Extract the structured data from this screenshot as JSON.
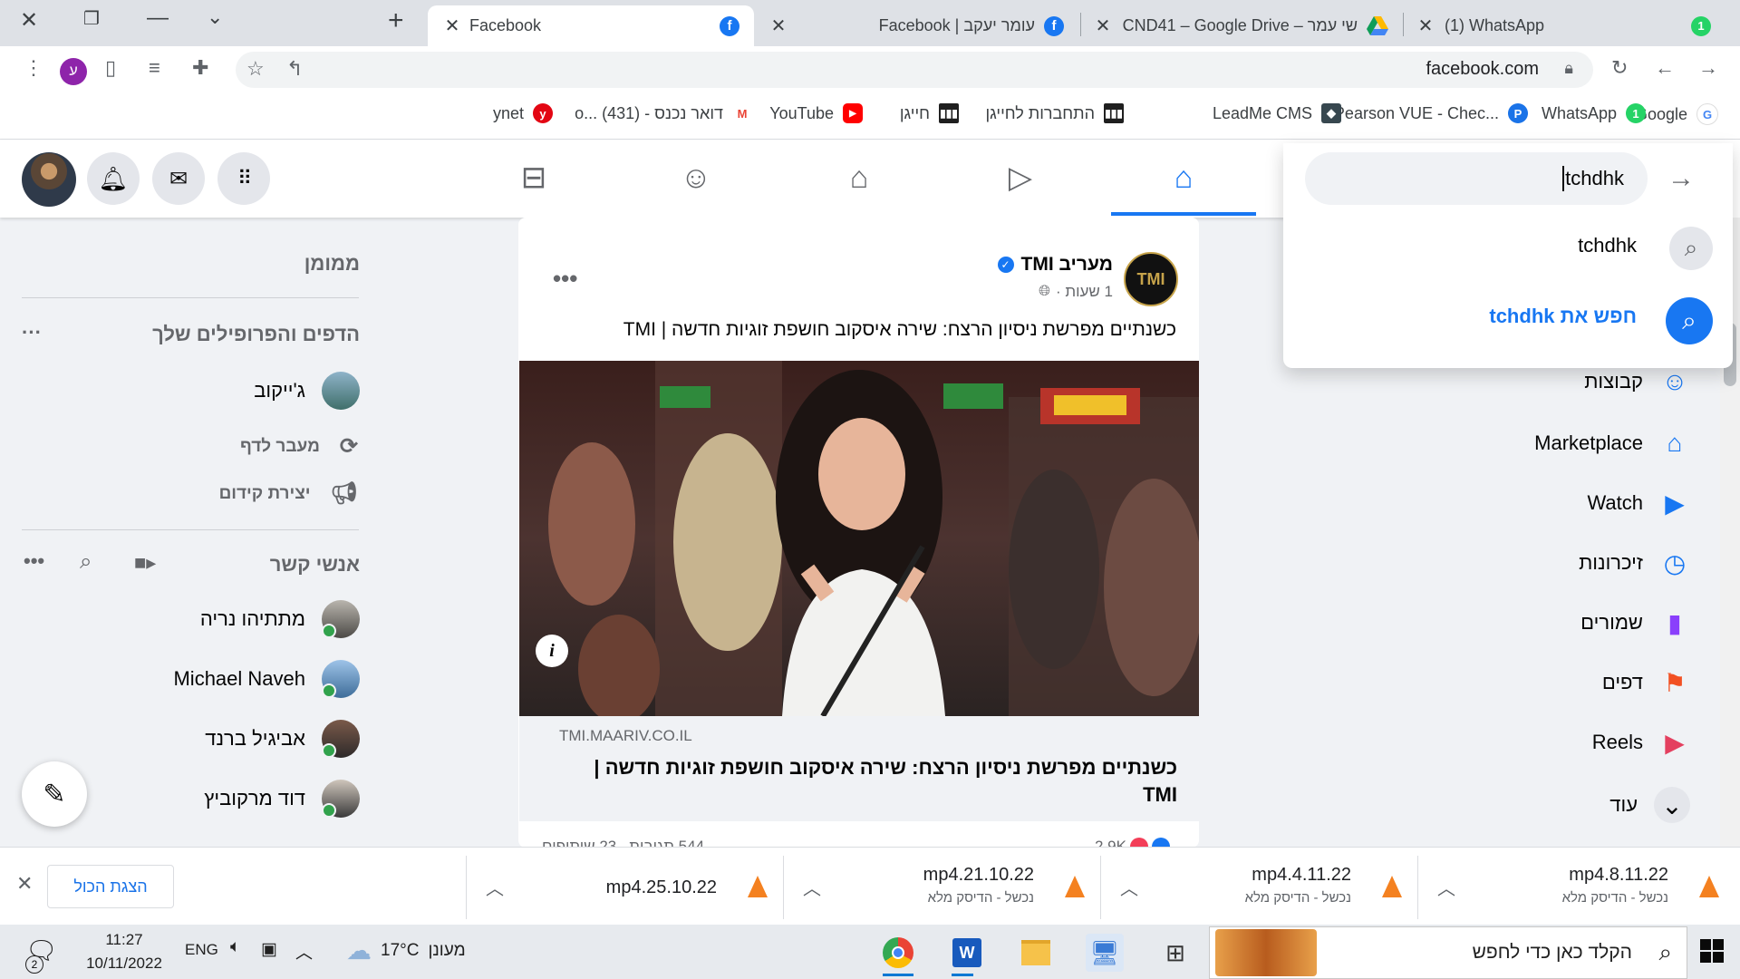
{
  "browser": {
    "tabs": [
      {
        "title": "Facebook",
        "active": true
      },
      {
        "title": "עומר יעקב | Facebook",
        "active": false
      },
      {
        "title": "שי עמר – CND41 – Google Drive",
        "active": false
      },
      {
        "title": "(1) WhatsApp",
        "active": false
      }
    ],
    "address": "facebook.com",
    "profile_letter": "ע",
    "bookmarks": [
      "Google",
      "WhatsApp",
      "Pearson VUE - Chec...",
      "LeadMe CMS",
      "התחברות לחייגן",
      "חייגן",
      "YouTube",
      "דואר נכנס - o... (431)",
      "ynet"
    ],
    "whatsapp_badge": "1"
  },
  "search": {
    "value": "tchdhk",
    "suggestion": "tchdhk",
    "search_prefix": "חפש את",
    "search_term": "tchdhk"
  },
  "left_nav": [
    {
      "label": "קבוצות",
      "icon": "groups-icon",
      "color": "#1877f2"
    },
    {
      "label": "Marketplace",
      "icon": "marketplace-icon",
      "color": "#1877f2"
    },
    {
      "label": "Watch",
      "icon": "watch-icon",
      "color": "#1877f2"
    },
    {
      "label": "זיכרונות",
      "icon": "memories-icon",
      "color": "#1877f2"
    },
    {
      "label": "שמורים",
      "icon": "saved-icon",
      "color": "#8a3ffc"
    },
    {
      "label": "דפים",
      "icon": "pages-icon",
      "color": "#f25022"
    },
    {
      "label": "Reels",
      "icon": "reels-icon",
      "color": "#e4405f"
    },
    {
      "label": "עוד",
      "icon": "chevron-down-icon",
      "color": "#050505"
    }
  ],
  "post": {
    "author": "מעריב TMI",
    "time": "1 שעות ·",
    "text": "כשנתיים מפרשת ניסיון הרצח: שירה איסקוב חושפת זוגיות חדשה | TMI",
    "link_domain": "TMI.MAARIV.CO.IL",
    "link_title": "כשנתיים מפרשת ניסיון הרצח: שירה איסקוב חושפת זוגיות חדשה | TMI",
    "reactions": "2.9K",
    "comments": "544 תגובות",
    "shares": "23 שיתופים"
  },
  "right_col": {
    "sponsored": "ממומן",
    "pages_title": "הדפים והפרופילים שלך",
    "page_name": "ג'ייקוב",
    "switch_page": "מעבר לדף",
    "promote": "יצירת קידום",
    "contacts_title": "אנשי קשר",
    "contacts": [
      "מתתיהו נריה",
      "Michael Naveh",
      "אביגיל ברנד",
      "דוד מרקוביץ"
    ]
  },
  "downloads": {
    "items": [
      {
        "name": "8.11.22.mp4",
        "status": "נכשל - הדיסק מלא"
      },
      {
        "name": "4.11.22.mp4",
        "status": "נכשל - הדיסק מלא"
      },
      {
        "name": "21.10.22.mp4",
        "status": "נכשל - הדיסק מלא"
      },
      {
        "name": "25.10.22.mp4",
        "status": ""
      }
    ],
    "show_all": "הצגת הכול"
  },
  "taskbar": {
    "search_placeholder": "הקלד כאן כדי לחפש",
    "weather_temp": "17°C",
    "weather_desc": "מעונן",
    "lang": "ENG",
    "time": "11:27",
    "date": "10/11/2022",
    "notif_count": "2"
  }
}
